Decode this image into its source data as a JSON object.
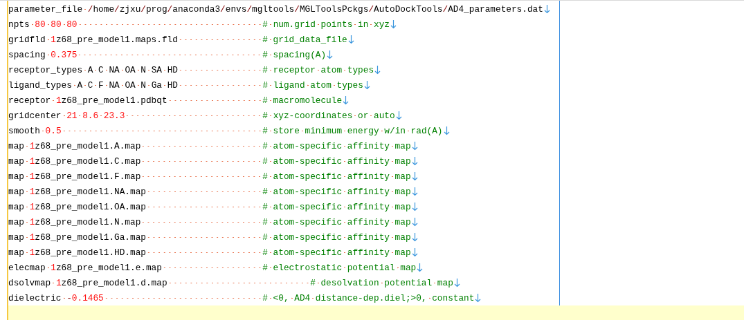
{
  "lines": [
    {
      "kind": "text",
      "current": false,
      "code": "parameter_file /home/zjxu/prog/anaconda3/envs/mgltools/MGLToolsPckgs/AutoDockTools/AD4_parameters.dat"
    },
    {
      "kind": "text",
      "current": false,
      "code": "npts 80 80 80",
      "comment": "# num.grid points in xyz"
    },
    {
      "kind": "text",
      "current": false,
      "code": "gridfld 1z68_pre_model1.maps.fld",
      "comment": "# grid_data_file"
    },
    {
      "kind": "text",
      "current": false,
      "code": "spacing 0.375",
      "comment": "# spacing(A)"
    },
    {
      "kind": "text",
      "current": false,
      "code": "receptor_types A C NA OA N SA HD",
      "comment": "# receptor atom types"
    },
    {
      "kind": "text",
      "current": false,
      "code": "ligand_types A C F NA OA N Ga HD",
      "comment": "# ligand atom types"
    },
    {
      "kind": "text",
      "current": false,
      "code": "receptor 1z68_pre_model1.pdbqt",
      "comment": "# macromolecule"
    },
    {
      "kind": "text",
      "current": false,
      "code": "gridcenter 21 8.6 23.3",
      "comment": "# xyz-coordinates or auto"
    },
    {
      "kind": "text",
      "current": false,
      "code": "smooth 0.5",
      "comment": "# store minimum energy w/in rad(A)"
    },
    {
      "kind": "text",
      "current": false,
      "code": "map 1z68_pre_model1.A.map",
      "comment": "# atom-specific affinity map"
    },
    {
      "kind": "text",
      "current": false,
      "code": "map 1z68_pre_model1.C.map",
      "comment": "# atom-specific affinity map"
    },
    {
      "kind": "text",
      "current": false,
      "code": "map 1z68_pre_model1.F.map",
      "comment": "# atom-specific affinity map"
    },
    {
      "kind": "text",
      "current": false,
      "code": "map 1z68_pre_model1.NA.map",
      "comment": "# atom-specific affinity map"
    },
    {
      "kind": "text",
      "current": false,
      "code": "map 1z68_pre_model1.OA.map",
      "comment": "# atom-specific affinity map"
    },
    {
      "kind": "text",
      "current": false,
      "code": "map 1z68_pre_model1.N.map",
      "comment": "# atom-specific affinity map"
    },
    {
      "kind": "text",
      "current": false,
      "code": "map 1z68_pre_model1.Ga.map",
      "comment": "# atom-specific affinity map"
    },
    {
      "kind": "text",
      "current": false,
      "code": "map 1z68_pre_model1.HD.map",
      "comment": "# atom-specific affinity map"
    },
    {
      "kind": "text",
      "current": false,
      "code": "elecmap 1z68_pre_model1.e.map",
      "comment": "# electrostatic potential map"
    },
    {
      "kind": "text",
      "current": false,
      "code": "dsolvmap 1z68_pre_model1.d.map",
      "comment": "         # desolvation potential map"
    },
    {
      "kind": "text",
      "current": false,
      "code": "dielectric -0.1465",
      "comment": "# <0, AD4 distance-dep.diel;>0, constant"
    },
    {
      "kind": "empty",
      "current": true
    }
  ]
}
